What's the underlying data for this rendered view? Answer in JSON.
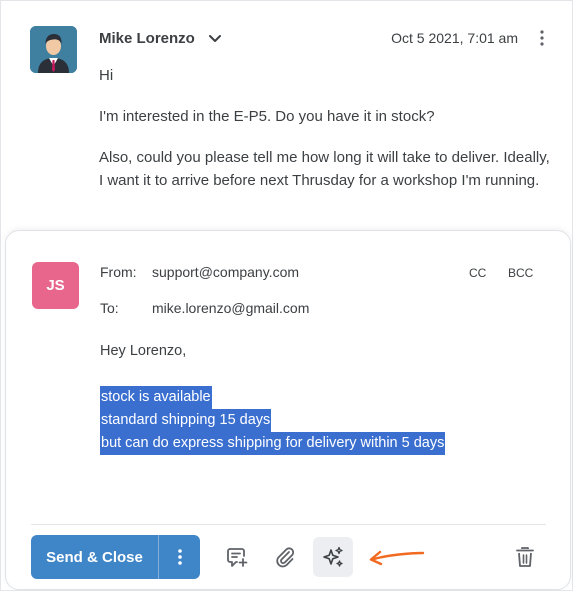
{
  "message": {
    "sender_name": "Mike Lorenzo",
    "date": "Oct 5 2021, 7:01 am",
    "avatar_icon": "person-avatar-icon",
    "paragraphs": [
      "Hi",
      "I'm interested in the E-P5. Do you have it in stock?",
      "Also, could you please tell me how long it will take to deliver. Ideally, I want it to arrive before next Thrusday for a workshop I'm running."
    ]
  },
  "composer": {
    "avatar_initials": "JS",
    "avatar_color": "#e8668c",
    "from_label": "From:",
    "from_value": "support@company.com",
    "to_label": "To:",
    "to_value": "mike.lorenzo@gmail.com",
    "cc_label": "CC",
    "bcc_label": "BCC",
    "greeting": "Hey Lorenzo,",
    "selected_lines": [
      "stock is available",
      "standard shipping 15 days",
      "but can do express shipping for delivery within 5 days"
    ],
    "selection_color": "#3a6fd0"
  },
  "toolbar": {
    "send_label": "Send & Close",
    "send_color": "#3f86c8",
    "icons": [
      "more-vertical-icon",
      "template-add-icon",
      "paperclip-icon",
      "ai-sparkle-icon",
      "trash-icon"
    ],
    "annotation_color": "#f26a21"
  }
}
